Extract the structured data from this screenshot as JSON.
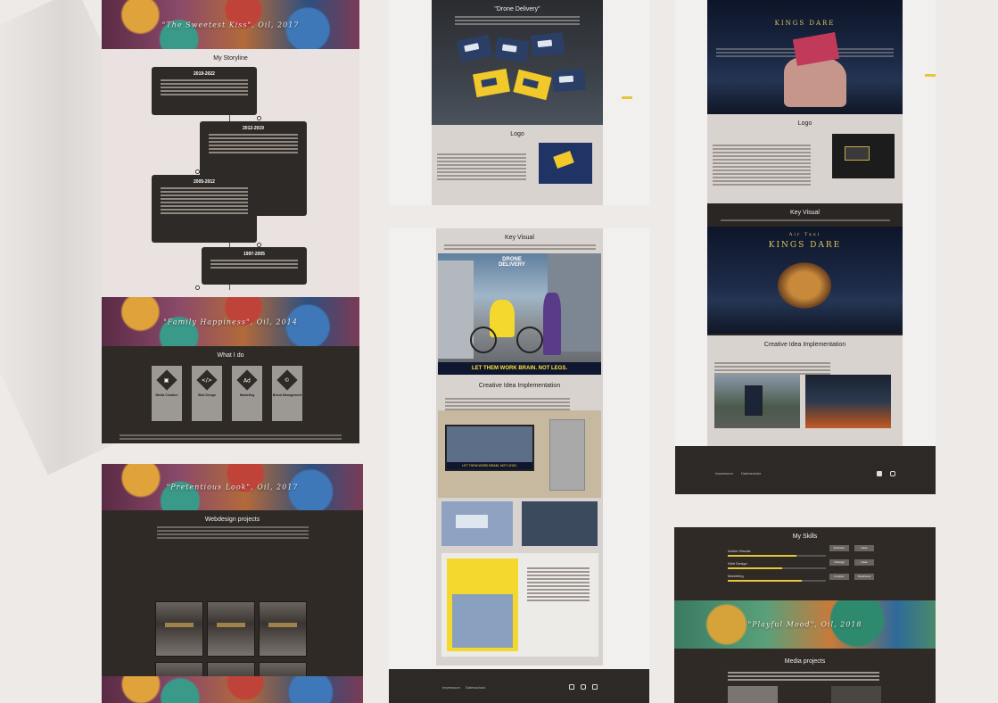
{
  "column_left": {
    "banner_top_title": "\"The Sweetest Kiss\", Oil, 2017",
    "storyline": {
      "title": "My Storyline",
      "entries": [
        {
          "years": "2019-2022",
          "heading": "Ellipse.",
          "text": "Remote work in Germany with my business at Blue Dark Studio (online), German Translator to Ellipse."
        },
        {
          "years": "2012-2019",
          "heading": "effective Brand Management projects",
          "text": "Building Content & Brand Management by Ammo Companies in Russia & Ukraine."
        },
        {
          "years": "2005-2012",
          "heading": "Ellipse.",
          "text": "Living and studying the first time in Europe in France."
        },
        {
          "years": "1997-2005",
          "heading": "English-specialized Lyceum.",
          "text": "Studying at English-specialized Lyceum. Being in the Professional Training, member of Brand Implementation."
        }
      ]
    },
    "painting_mid_title": "\"Family Happiness\", Oil, 2014",
    "what_i_do": {
      "title": "What I do",
      "cards": [
        {
          "label": "Media Creation",
          "icon": "camera-icon",
          "glyph": "▣"
        },
        {
          "label": "Web Design",
          "icon": "code-icon",
          "glyph": "</>"
        },
        {
          "label": "Marketing",
          "icon": "ad-icon",
          "glyph": "Ad"
        },
        {
          "label": "Brand Management",
          "icon": "copyright-icon",
          "glyph": "©"
        }
      ]
    },
    "painting_bottom_title": "\"Pretentious Look\", Oil, 2017",
    "webdesign": {
      "title": "Webdesign projects"
    }
  },
  "column_middle": {
    "drone_title": "\"Drone Delivery\"",
    "logo_title": "Logo",
    "key_visual_title": "Key Visual",
    "creative_title": "Creative Idea Implementation",
    "slogan": "LET THEM WORK BRAIN. NOT LEGS.",
    "brand_name": "DRONE DELIVERY",
    "footer": {
      "links": [
        "Impressum",
        "Datenschutz"
      ]
    }
  },
  "column_right": {
    "brand_name": "KINGS DARE",
    "brand_sub": "Air Taxi",
    "logo_title": "Logo",
    "key_visual_title": "Key Visual",
    "creative_title": "Creative Idea Implementation",
    "footer": {
      "links": [
        "Impressum",
        "Datenschutz"
      ]
    },
    "skills": {
      "title": "My Skills",
      "rows": [
        {
          "label": "Adobe Visuals",
          "level": 0.7
        },
        {
          "label": "Web Design",
          "level": 0.55
        },
        {
          "label": "Marketing",
          "level": 0.75
        }
      ],
      "pills": [
        "Illustrator",
        "Ideas",
        "InDesign",
        "Ideas",
        "Analysis",
        "Readiness"
      ]
    },
    "painting_title": "\"Playful Mood\", Oil, 2018",
    "media_title": "Media projects"
  },
  "colors": {
    "background": "#eeeae7",
    "dark": "#2f2a26",
    "accent": "#e6c73c",
    "navy": "#2b3f66"
  }
}
